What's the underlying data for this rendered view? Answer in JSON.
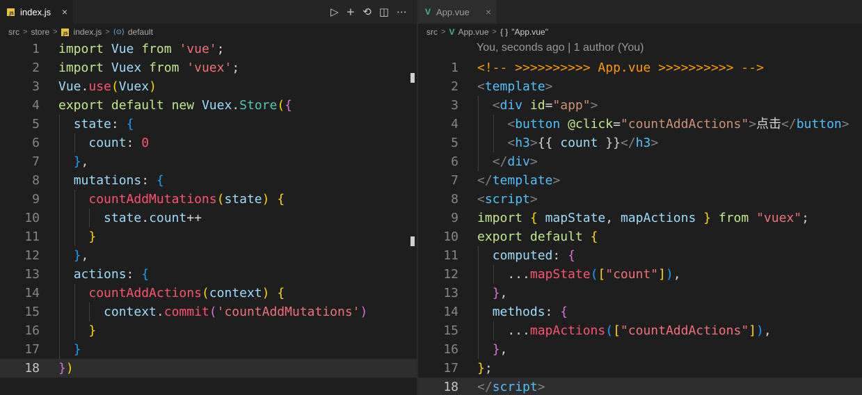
{
  "left": {
    "tab": {
      "name": "index.js",
      "badge": "JS",
      "close": "×"
    },
    "actions": [
      "▷",
      "+",
      "⟲",
      "◫",
      "⋯"
    ],
    "breadcrumb": {
      "items": [
        "src",
        "store",
        "index.js",
        "default"
      ],
      "sep": ">",
      "default_icon": "⟨⊙⟩"
    },
    "lines": [
      {
        "n": "1",
        "tokens": [
          [
            "kw",
            "import"
          ],
          [
            "pn",
            " "
          ],
          [
            "id",
            "Vue"
          ],
          [
            "pn",
            " "
          ],
          [
            "kw",
            "from"
          ],
          [
            "pn",
            " "
          ],
          [
            "str",
            "'vue'"
          ],
          [
            "pn",
            ";"
          ]
        ]
      },
      {
        "n": "2",
        "tokens": [
          [
            "kw",
            "import"
          ],
          [
            "pn",
            " "
          ],
          [
            "id",
            "Vuex"
          ],
          [
            "pn",
            " "
          ],
          [
            "kw",
            "from"
          ],
          [
            "pn",
            " "
          ],
          [
            "str",
            "'vuex'"
          ],
          [
            "pn",
            ";"
          ]
        ]
      },
      {
        "n": "3",
        "tokens": [
          [
            "id",
            "Vue"
          ],
          [
            "pn",
            "."
          ],
          [
            "fn",
            "use"
          ],
          [
            "br1",
            "("
          ],
          [
            "id",
            "Vuex"
          ],
          [
            "br1",
            ")"
          ]
        ]
      },
      {
        "n": "4",
        "tokens": [
          [
            "kw",
            "export"
          ],
          [
            "pn",
            " "
          ],
          [
            "kw",
            "default"
          ],
          [
            "pn",
            " "
          ],
          [
            "kw",
            "new"
          ],
          [
            "pn",
            " "
          ],
          [
            "id",
            "Vuex"
          ],
          [
            "pn",
            "."
          ],
          [
            "cls",
            "Store"
          ],
          [
            "br1",
            "("
          ],
          [
            "br2",
            "{"
          ]
        ]
      },
      {
        "n": "5",
        "tokens": [
          [
            "pn",
            "  "
          ],
          [
            "prop",
            "state"
          ],
          [
            "pn",
            ": "
          ],
          [
            "br3",
            "{"
          ]
        ]
      },
      {
        "n": "6",
        "tokens": [
          [
            "pn",
            "    "
          ],
          [
            "prop",
            "count"
          ],
          [
            "pn",
            ": "
          ],
          [
            "num0",
            "0"
          ]
        ]
      },
      {
        "n": "7",
        "tokens": [
          [
            "pn",
            "  "
          ],
          [
            "br3",
            "}"
          ],
          [
            "pn",
            ","
          ]
        ]
      },
      {
        "n": "8",
        "tokens": [
          [
            "pn",
            "  "
          ],
          [
            "prop",
            "mutations"
          ],
          [
            "pn",
            ": "
          ],
          [
            "br3",
            "{"
          ]
        ]
      },
      {
        "n": "9",
        "tokens": [
          [
            "pn",
            "    "
          ],
          [
            "fn",
            "countAddMutations"
          ],
          [
            "br1",
            "("
          ],
          [
            "prop",
            "state"
          ],
          [
            "br1",
            ")"
          ],
          [
            "pn",
            " "
          ],
          [
            "br1",
            "{"
          ]
        ]
      },
      {
        "n": "10",
        "tokens": [
          [
            "pn",
            "      "
          ],
          [
            "prop",
            "state"
          ],
          [
            "pn",
            "."
          ],
          [
            "prop",
            "count"
          ],
          [
            "pn",
            "++"
          ]
        ]
      },
      {
        "n": "11",
        "tokens": [
          [
            "pn",
            "    "
          ],
          [
            "br1",
            "}"
          ]
        ]
      },
      {
        "n": "12",
        "tokens": [
          [
            "pn",
            "  "
          ],
          [
            "br3",
            "}"
          ],
          [
            "pn",
            ","
          ]
        ]
      },
      {
        "n": "13",
        "tokens": [
          [
            "pn",
            "  "
          ],
          [
            "prop",
            "actions"
          ],
          [
            "pn",
            ": "
          ],
          [
            "br3",
            "{"
          ]
        ]
      },
      {
        "n": "14",
        "tokens": [
          [
            "pn",
            "    "
          ],
          [
            "fn",
            "countAddActions"
          ],
          [
            "br1",
            "("
          ],
          [
            "prop",
            "context"
          ],
          [
            "br1",
            ")"
          ],
          [
            "pn",
            " "
          ],
          [
            "br1",
            "{"
          ]
        ]
      },
      {
        "n": "15",
        "tokens": [
          [
            "pn",
            "      "
          ],
          [
            "prop",
            "context"
          ],
          [
            "pn",
            "."
          ],
          [
            "fn",
            "commit"
          ],
          [
            "br2",
            "("
          ],
          [
            "str",
            "'countAddMutations'"
          ],
          [
            "br2",
            ")"
          ]
        ]
      },
      {
        "n": "16",
        "tokens": [
          [
            "pn",
            "    "
          ],
          [
            "br1",
            "}"
          ]
        ]
      },
      {
        "n": "17",
        "tokens": [
          [
            "pn",
            "  "
          ],
          [
            "br3",
            "}"
          ]
        ]
      },
      {
        "n": "18",
        "tokens": [
          [
            "br2",
            "}"
          ],
          [
            "br1",
            ")"
          ]
        ]
      }
    ]
  },
  "right": {
    "tab": {
      "name": "App.vue",
      "icon": "V",
      "close": "×"
    },
    "breadcrumb": {
      "items": [
        "src",
        "App.vue",
        "\"App.vue\""
      ],
      "sep": ">",
      "braces": "{ }",
      "vue_icon": "V"
    },
    "blame": "You, seconds ago | 1 author (You)",
    "lines": [
      {
        "n": "1",
        "tokens": [
          [
            "cm",
            "<!-- >>>>>>>>>> App.vue >>>>>>>>>> -->"
          ]
        ]
      },
      {
        "n": "2",
        "tokens": [
          [
            "ang",
            "<"
          ],
          [
            "tg",
            "template"
          ],
          [
            "ang",
            ">"
          ]
        ]
      },
      {
        "n": "3",
        "tokens": [
          [
            "pn",
            "  "
          ],
          [
            "ang",
            "<"
          ],
          [
            "tg",
            "div"
          ],
          [
            "pn",
            " "
          ],
          [
            "at",
            "id"
          ],
          [
            "pn",
            "="
          ],
          [
            "av",
            "\"app\""
          ],
          [
            "ang",
            ">"
          ]
        ]
      },
      {
        "n": "4",
        "tokens": [
          [
            "pn",
            "    "
          ],
          [
            "ang",
            "<"
          ],
          [
            "tg",
            "button"
          ],
          [
            "pn",
            " "
          ],
          [
            "at",
            "@click"
          ],
          [
            "pn",
            "="
          ],
          [
            "av",
            "\"countAddActions\""
          ],
          [
            "ang",
            ">"
          ],
          [
            "pn",
            "点击"
          ],
          [
            "ang",
            "</"
          ],
          [
            "tg",
            "button"
          ],
          [
            "ang",
            ">"
          ]
        ]
      },
      {
        "n": "5",
        "tokens": [
          [
            "pn",
            "    "
          ],
          [
            "ang",
            "<"
          ],
          [
            "tg",
            "h3"
          ],
          [
            "ang",
            ">"
          ],
          [
            "pn",
            "{{ "
          ],
          [
            "prop",
            "count"
          ],
          [
            "pn",
            " }}"
          ],
          [
            "ang",
            "</"
          ],
          [
            "tg",
            "h3"
          ],
          [
            "ang",
            ">"
          ]
        ]
      },
      {
        "n": "6",
        "tokens": [
          [
            "pn",
            "  "
          ],
          [
            "ang",
            "</"
          ],
          [
            "tg",
            "div"
          ],
          [
            "ang",
            ">"
          ]
        ]
      },
      {
        "n": "7",
        "tokens": [
          [
            "ang",
            "</"
          ],
          [
            "tg",
            "template"
          ],
          [
            "ang",
            ">"
          ]
        ]
      },
      {
        "n": "8",
        "tokens": [
          [
            "ang",
            "<"
          ],
          [
            "tg",
            "script"
          ],
          [
            "ang",
            ">"
          ]
        ]
      },
      {
        "n": "9",
        "tokens": [
          [
            "kw",
            "import"
          ],
          [
            "pn",
            " "
          ],
          [
            "br1",
            "{"
          ],
          [
            "pn",
            " "
          ],
          [
            "prop",
            "mapState"
          ],
          [
            "pn",
            ", "
          ],
          [
            "prop",
            "mapActions"
          ],
          [
            "pn",
            " "
          ],
          [
            "br1",
            "}"
          ],
          [
            "pn",
            " "
          ],
          [
            "kw",
            "from"
          ],
          [
            "pn",
            " "
          ],
          [
            "str",
            "\"vuex\""
          ],
          [
            "pn",
            ";"
          ]
        ]
      },
      {
        "n": "10",
        "tokens": [
          [
            "kw",
            "export"
          ],
          [
            "pn",
            " "
          ],
          [
            "kw",
            "default"
          ],
          [
            "pn",
            " "
          ],
          [
            "br1",
            "{"
          ]
        ]
      },
      {
        "n": "11",
        "tokens": [
          [
            "pn",
            "  "
          ],
          [
            "prop",
            "computed"
          ],
          [
            "pn",
            ": "
          ],
          [
            "br2",
            "{"
          ]
        ]
      },
      {
        "n": "12",
        "tokens": [
          [
            "pn",
            "    ..."
          ],
          [
            "fn",
            "mapState"
          ],
          [
            "br3",
            "("
          ],
          [
            "br1",
            "["
          ],
          [
            "str",
            "\"count\""
          ],
          [
            "br1",
            "]"
          ],
          [
            "br3",
            ")"
          ],
          [
            "pn",
            ","
          ]
        ]
      },
      {
        "n": "13",
        "tokens": [
          [
            "pn",
            "  "
          ],
          [
            "br2",
            "}"
          ],
          [
            "pn",
            ","
          ]
        ]
      },
      {
        "n": "14",
        "tokens": [
          [
            "pn",
            "  "
          ],
          [
            "prop",
            "methods"
          ],
          [
            "pn",
            ": "
          ],
          [
            "br2",
            "{"
          ]
        ]
      },
      {
        "n": "15",
        "tokens": [
          [
            "pn",
            "    ..."
          ],
          [
            "fn",
            "mapActions"
          ],
          [
            "br3",
            "("
          ],
          [
            "br1",
            "["
          ],
          [
            "str",
            "\"countAddActions\""
          ],
          [
            "br1",
            "]"
          ],
          [
            "br3",
            ")"
          ],
          [
            "pn",
            ","
          ]
        ]
      },
      {
        "n": "16",
        "tokens": [
          [
            "pn",
            "  "
          ],
          [
            "br2",
            "}"
          ],
          [
            "pn",
            ","
          ]
        ]
      },
      {
        "n": "17",
        "tokens": [
          [
            "br1",
            "}"
          ],
          [
            "pn",
            ";"
          ]
        ]
      },
      {
        "n": "18",
        "tokens": [
          [
            "ang",
            "</"
          ],
          [
            "tg",
            "script"
          ],
          [
            "ang",
            ">"
          ]
        ]
      }
    ]
  }
}
